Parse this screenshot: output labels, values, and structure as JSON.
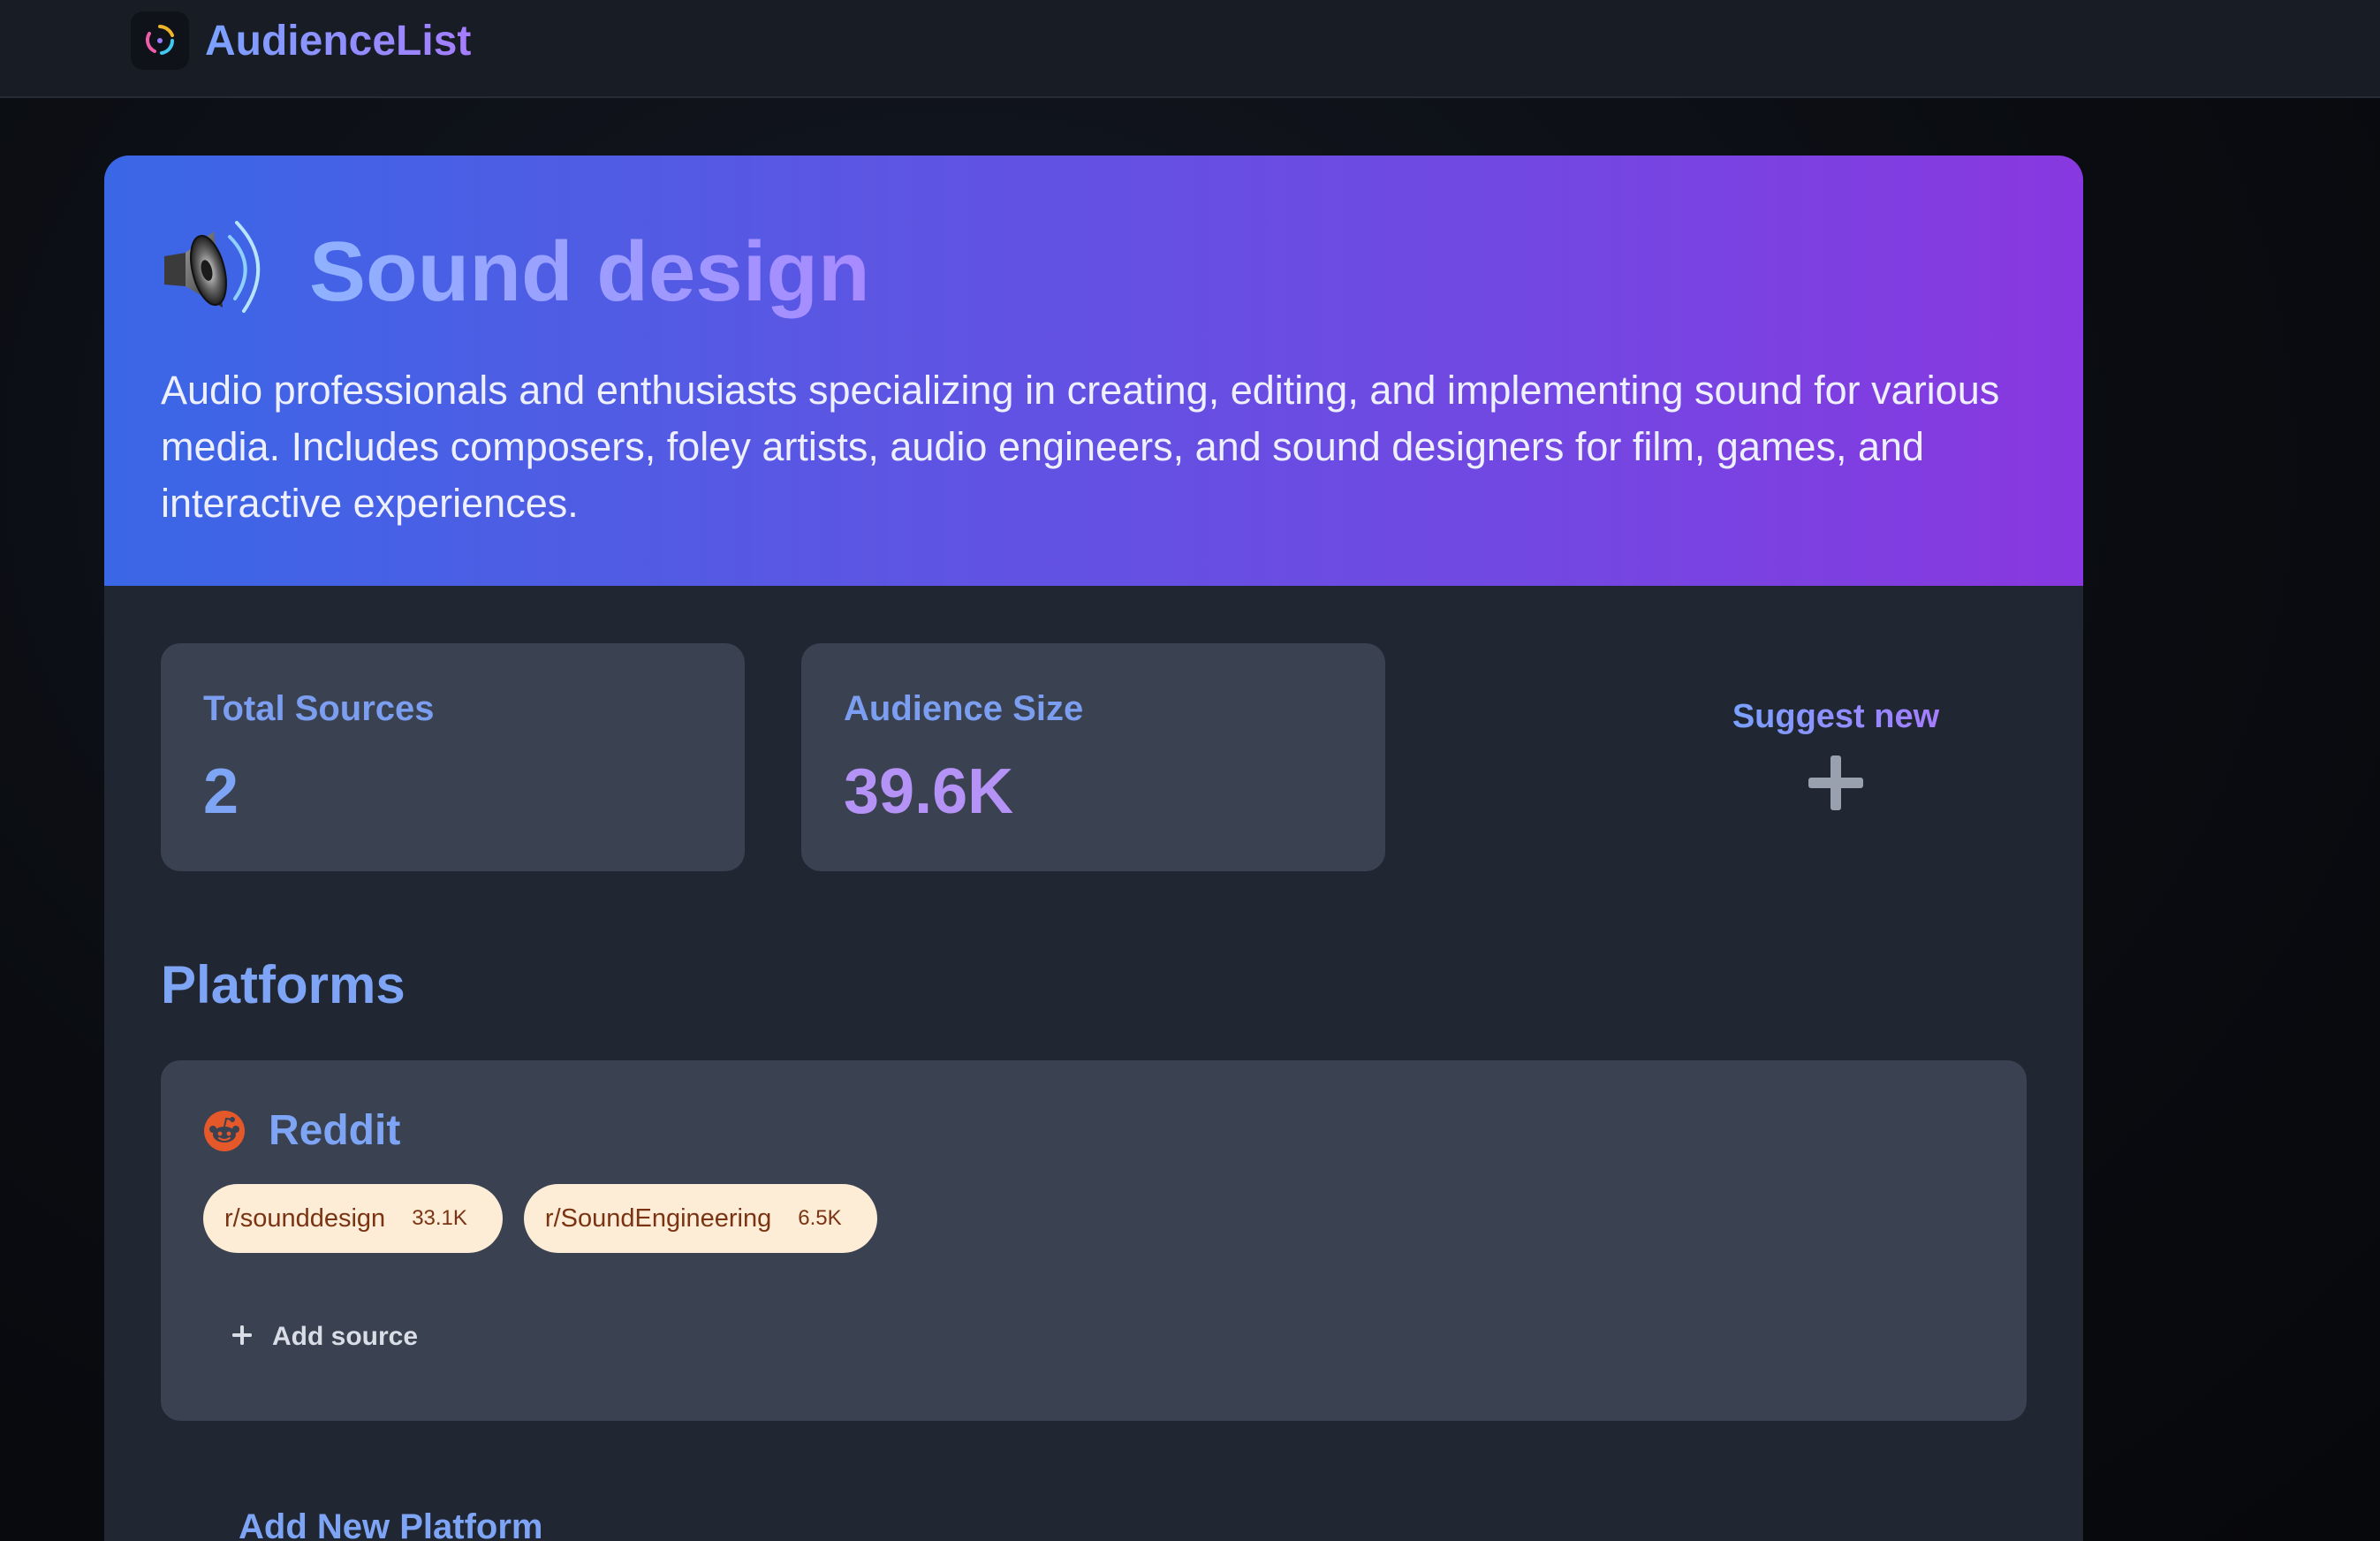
{
  "app": {
    "name": "AudienceList"
  },
  "audience": {
    "title": "Sound design",
    "icon": "speaker-icon",
    "description": "Audio professionals and enthusiasts specializing in creating, editing, and implementing sound for various media. Includes composers, foley artists, audio engineers, and sound designers for film, games, and interactive experiences."
  },
  "stats": {
    "total_sources": {
      "label": "Total Sources",
      "value": "2"
    },
    "audience_size": {
      "label": "Audience Size",
      "value": "39.6K"
    }
  },
  "suggest": {
    "label": "Suggest new",
    "icon": "plus-icon"
  },
  "platforms_section": {
    "title": "Platforms",
    "platforms": [
      {
        "name": "Reddit",
        "icon": "reddit-icon",
        "sources": [
          {
            "name": "r/sounddesign",
            "count": "33.1K"
          },
          {
            "name": "r/SoundEngineering",
            "count": "6.5K"
          }
        ],
        "add_source_label": "Add source"
      }
    ],
    "add_platform_label": "Add New Platform"
  },
  "colors": {
    "hero_gradient_start": "#3a67e6",
    "hero_gradient_end": "#8838e0",
    "accent_blue": "#7ea4f5",
    "accent_purple": "#b592f5",
    "reddit_orange": "#e5582a",
    "chip_bg": "#fdecd6"
  }
}
